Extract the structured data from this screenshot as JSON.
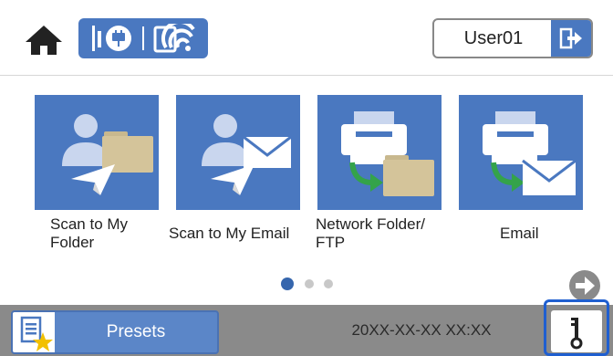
{
  "header": {
    "user_name": "User01",
    "icons": [
      "home-icon",
      "ethernet-icon",
      "wifi-icon",
      "logout-icon"
    ]
  },
  "tiles": [
    {
      "line1": "Scan to My",
      "line2": "Folder",
      "icon": "scan-to-folder-icon"
    },
    {
      "line1": "Scan to My Email",
      "line2": "",
      "icon": "scan-to-email-icon"
    },
    {
      "line1": "Network Folder/",
      "line2": "FTP",
      "icon": "network-folder-icon"
    },
    {
      "line1": "Email",
      "line2": "",
      "icon": "email-icon"
    }
  ],
  "pagination": {
    "current_page": 1,
    "total_pages": 3
  },
  "footer": {
    "presets_label": "Presets",
    "datetime": "20XX-XX-XX XX:XX"
  },
  "colors": {
    "accent": "#4a78c0",
    "bar": "#8a8a8a",
    "highlight": "#1f5fd0"
  }
}
